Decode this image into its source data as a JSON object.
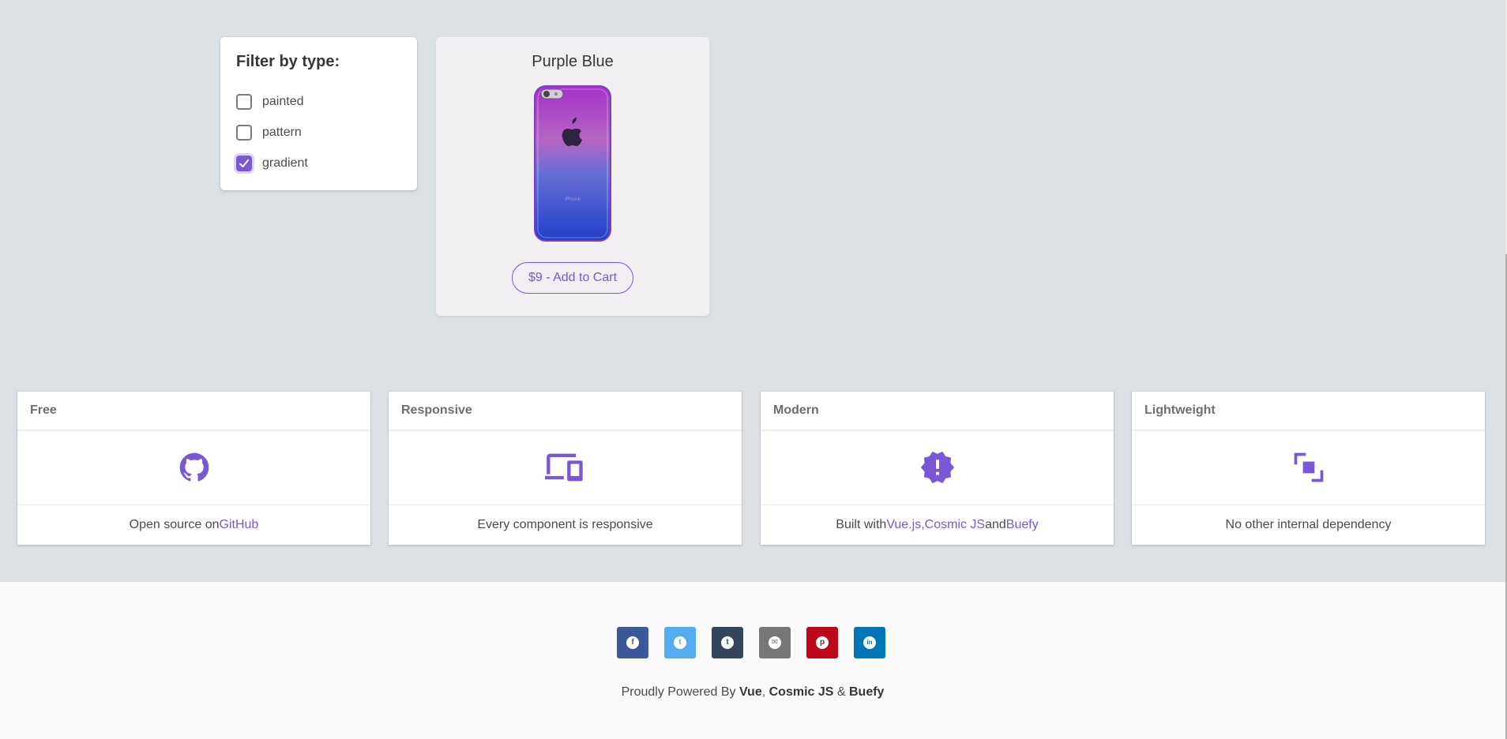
{
  "filter": {
    "title": "Filter by type:",
    "options": [
      {
        "label": "painted",
        "checked": false
      },
      {
        "label": "pattern",
        "checked": false
      },
      {
        "label": "gradient",
        "checked": true
      }
    ]
  },
  "product": {
    "name": "Purple Blue",
    "button_label": "$9 - Add to Cart"
  },
  "features": [
    {
      "header": "Free",
      "icon": "github-icon",
      "text_before": "Open source on ",
      "link1": "GitHub",
      "text_mid": "",
      "link2": "",
      "text_and": "",
      "link3": "",
      "text_after": ""
    },
    {
      "header": "Responsive",
      "icon": "devices-icon",
      "text_before": "Every component is responsive",
      "link1": "",
      "text_mid": "",
      "link2": "",
      "text_and": "",
      "link3": "",
      "text_after": ""
    },
    {
      "header": "Modern",
      "icon": "alert-decagram-icon",
      "text_before": "Built with ",
      "link1": "Vue.js",
      "text_mid": ", ",
      "link2": "Cosmic JS",
      "text_and": " and ",
      "link3": "Buefy",
      "text_after": ""
    },
    {
      "header": "Lightweight",
      "icon": "arrange-icon",
      "text_before": "No other internal dependency",
      "link1": "",
      "text_mid": "",
      "link2": "",
      "text_and": "",
      "link3": "",
      "text_after": ""
    }
  ],
  "footer": {
    "share": [
      {
        "name": "facebook",
        "icon": "facebook-icon",
        "color": "#3b5998",
        "glyph": "f"
      },
      {
        "name": "twitter",
        "icon": "twitter-icon",
        "color": "#55acee",
        "glyph": "t"
      },
      {
        "name": "tumblr",
        "icon": "tumblr-icon",
        "color": "#35465c",
        "glyph": "t"
      },
      {
        "name": "email",
        "icon": "email-icon",
        "color": "#777777",
        "glyph": "✉"
      },
      {
        "name": "pinterest",
        "icon": "pinterest-icon",
        "color": "#bd081c",
        "glyph": "p"
      },
      {
        "name": "linkedin",
        "icon": "linkedin-icon",
        "color": "#0077b5",
        "glyph": "in"
      }
    ],
    "powered_prefix": "Proudly Powered By ",
    "powered_vue": "Vue",
    "powered_sep1": ", ",
    "powered_cosmic": "Cosmic JS",
    "powered_sep2": " & ",
    "powered_buefy": "Buefy"
  },
  "colors": {
    "accent": "#7957d5",
    "page_bg": "#dae0e3",
    "footer_bg": "#fafafa",
    "product_bg": "#f2eff3"
  }
}
